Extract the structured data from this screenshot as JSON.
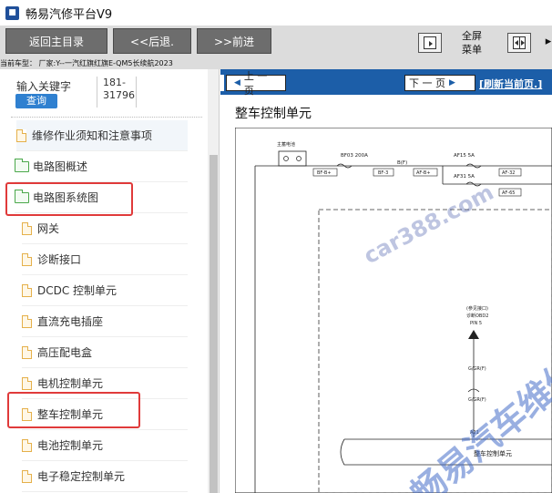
{
  "app": {
    "title": "畅易汽修平台V9"
  },
  "toolbar": {
    "home_label": "返回主目录",
    "back_label": "<<后退.",
    "forward_label": ">>前进",
    "fullscreen_label_1": "全屏",
    "fullscreen_label_2": "菜单"
  },
  "vehicle": {
    "info": "当前车型：  厂家:Y--一汽红旗红旗E-QM5长续航2023"
  },
  "sidebar": {
    "search_label": "输入关键字",
    "search_button": "查询",
    "id_line1": "181-",
    "id_line2": "31796",
    "items": [
      {
        "label": "维修作业须知和注意事项",
        "icon": "document-icon"
      },
      {
        "label": "电路图概述",
        "icon": "folder-icon"
      },
      {
        "label": "电路图系统图",
        "icon": "folder-open-icon"
      },
      {
        "label": "网关",
        "icon": "document-icon"
      },
      {
        "label": "诊断接口",
        "icon": "document-icon"
      },
      {
        "label": "DCDC 控制单元",
        "icon": "document-icon"
      },
      {
        "label": "直流充电插座",
        "icon": "document-icon"
      },
      {
        "label": "高压配电盒",
        "icon": "document-icon"
      },
      {
        "label": "电机控制单元",
        "icon": "document-icon"
      },
      {
        "label": "整车控制单元",
        "icon": "document-icon"
      },
      {
        "label": "电池控制单元",
        "icon": "document-icon"
      },
      {
        "label": "电子稳定控制单元",
        "icon": "document-icon"
      }
    ]
  },
  "viewer": {
    "prev_label": "上 一 页",
    "next_label": "下 一 页",
    "refresh_label": "[刷新当前页.]",
    "title": "整车控制单元"
  },
  "diagram": {
    "main_relay": "主蓄电池",
    "fuse1": "BF03 200A",
    "net_bf": "B(F)",
    "fuse2": "AF15 5A",
    "fuse3": "AF31 5A",
    "con_bfb": "BF-B+",
    "con_bf3": "BF-3",
    "con_afb": "AF-B+",
    "con_af32": "AF-32",
    "con_af65": "AF-65",
    "obd_1": "(参见接口)",
    "obd_2": "诊断OBD2",
    "obd_3": "PIN 5",
    "wire1": "G/GR(F)",
    "wire2": "G/GR(F)",
    "pin": "A21",
    "module": "整车控制单元"
  },
  "watermarks": {
    "site": "car388.com",
    "brand": "畅易汽车维修"
  },
  "colors": {
    "accent": "#1c5ea8",
    "highlight": "#e03a3a",
    "query_button": "#2f80d0"
  }
}
